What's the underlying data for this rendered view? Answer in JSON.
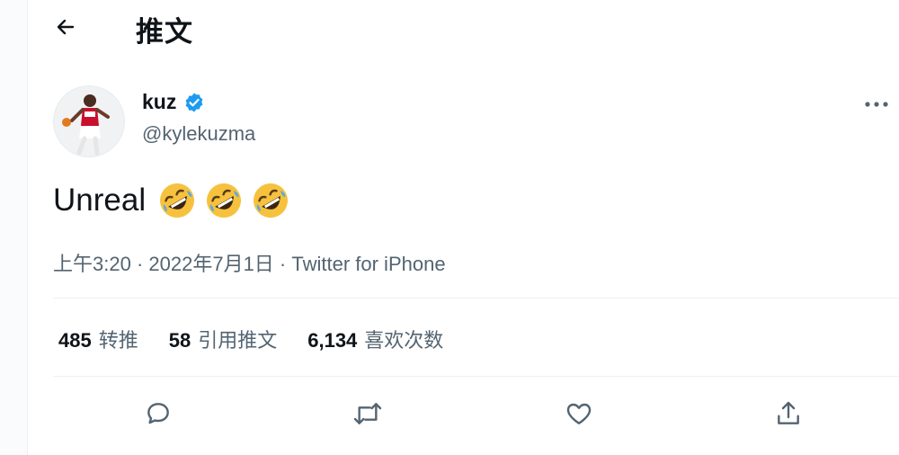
{
  "header": {
    "title": "推文"
  },
  "author": {
    "display_name": "kuz",
    "handle": "@kylekuzma",
    "verified_color": "#1d9bf0"
  },
  "tweet": {
    "text": "Unreal",
    "emojis": [
      "rolling-on-floor-laughing",
      "rolling-on-floor-laughing",
      "rolling-on-floor-laughing"
    ]
  },
  "meta": {
    "time": "上午3:20",
    "sep": " · ",
    "date": "2022年7月1日",
    "source": "Twitter for iPhone"
  },
  "stats": [
    {
      "count": "485",
      "label": "转推"
    },
    {
      "count": "58",
      "label": "引用推文"
    },
    {
      "count": "6,134",
      "label": "喜欢次数"
    }
  ],
  "actions": [
    "reply-icon",
    "retweet-icon",
    "like-icon",
    "share-icon"
  ],
  "colors": {
    "text": "#0f1419",
    "secondary": "#536471",
    "accent": "#1d9bf0"
  }
}
